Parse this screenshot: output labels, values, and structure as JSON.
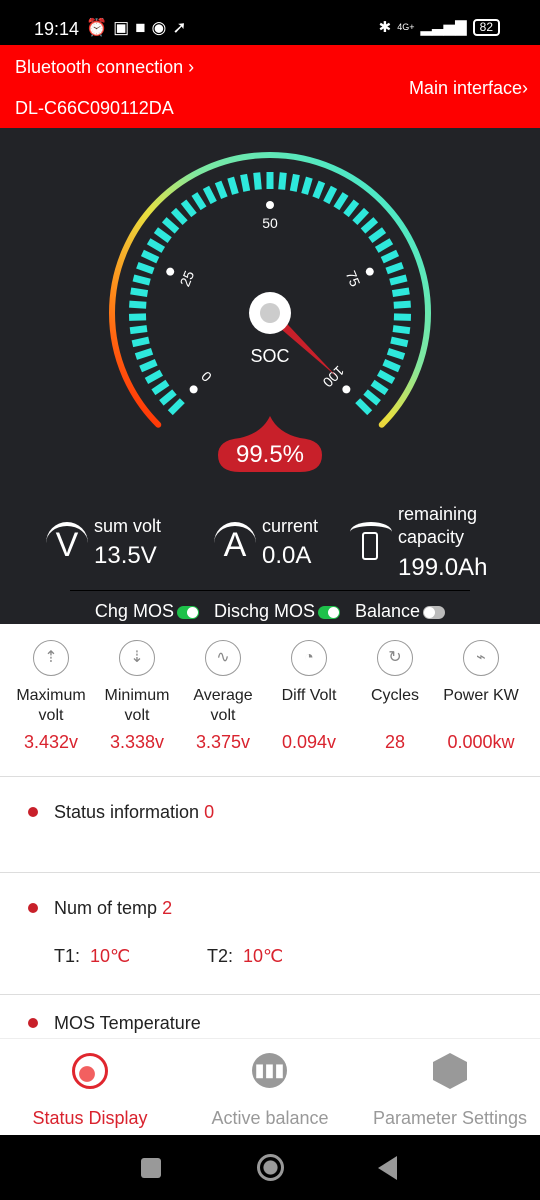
{
  "status_bar": {
    "time": "19:14",
    "battery": "82",
    "network": "4G+"
  },
  "header": {
    "bluetooth_label": "Bluetooth connection",
    "device_id": "DL-C66C090112DA",
    "main_interface": "Main interface"
  },
  "gauge": {
    "label": "SOC",
    "value_text": "99.5%",
    "value": 99.5,
    "ticks": [
      "0",
      "25",
      "50",
      "75",
      "100"
    ]
  },
  "summary": {
    "sum_volt": {
      "label": "sum volt",
      "value": "13.5V"
    },
    "current": {
      "label": "current",
      "value": "0.0A"
    },
    "capacity": {
      "label1": "remaining",
      "label2": "capacity",
      "value": "199.0Ah"
    }
  },
  "switches": [
    {
      "label": "Chg MOS",
      "on": true
    },
    {
      "label": "Dischg MOS",
      "on": true
    },
    {
      "label": "Balance",
      "on": false
    }
  ],
  "metrics": [
    {
      "name1": "Maximum",
      "name2": "volt",
      "value": "3.432v",
      "icon": "max-volt-icon"
    },
    {
      "name1": "Minimum",
      "name2": "volt",
      "value": "3.338v",
      "icon": "min-volt-icon"
    },
    {
      "name1": "Average",
      "name2": "volt",
      "value": "3.375v",
      "icon": "sine-wave-icon"
    },
    {
      "name1": "Diff Volt",
      "name2": "",
      "value": "0.094v",
      "icon": "gauge-icon"
    },
    {
      "name1": "Cycles",
      "name2": "",
      "value": "28",
      "icon": "cycle-bolt-icon"
    },
    {
      "name1": "Power KW",
      "name2": "",
      "value": "0.000kw",
      "icon": "power-pulse-icon"
    }
  ],
  "sections": {
    "status_info": {
      "label": "Status information",
      "count": "0"
    },
    "num_temp": {
      "label": "Num of temp",
      "count": "2",
      "t1_label": "T1:",
      "t1": "10℃",
      "t2_label": "T2:",
      "t2": "10℃"
    },
    "mos_temp": {
      "label": "MOS Temperature"
    }
  },
  "tabs": [
    {
      "label": "Status Display",
      "active": true
    },
    {
      "label": "Active balance"
    },
    {
      "label": "Parameter Settings"
    }
  ],
  "colors": {
    "accent": "#fe0000",
    "value_red": "#d9232e",
    "gauge_ticks": "#2ee8dc",
    "switch_on": "#1ec14a"
  }
}
